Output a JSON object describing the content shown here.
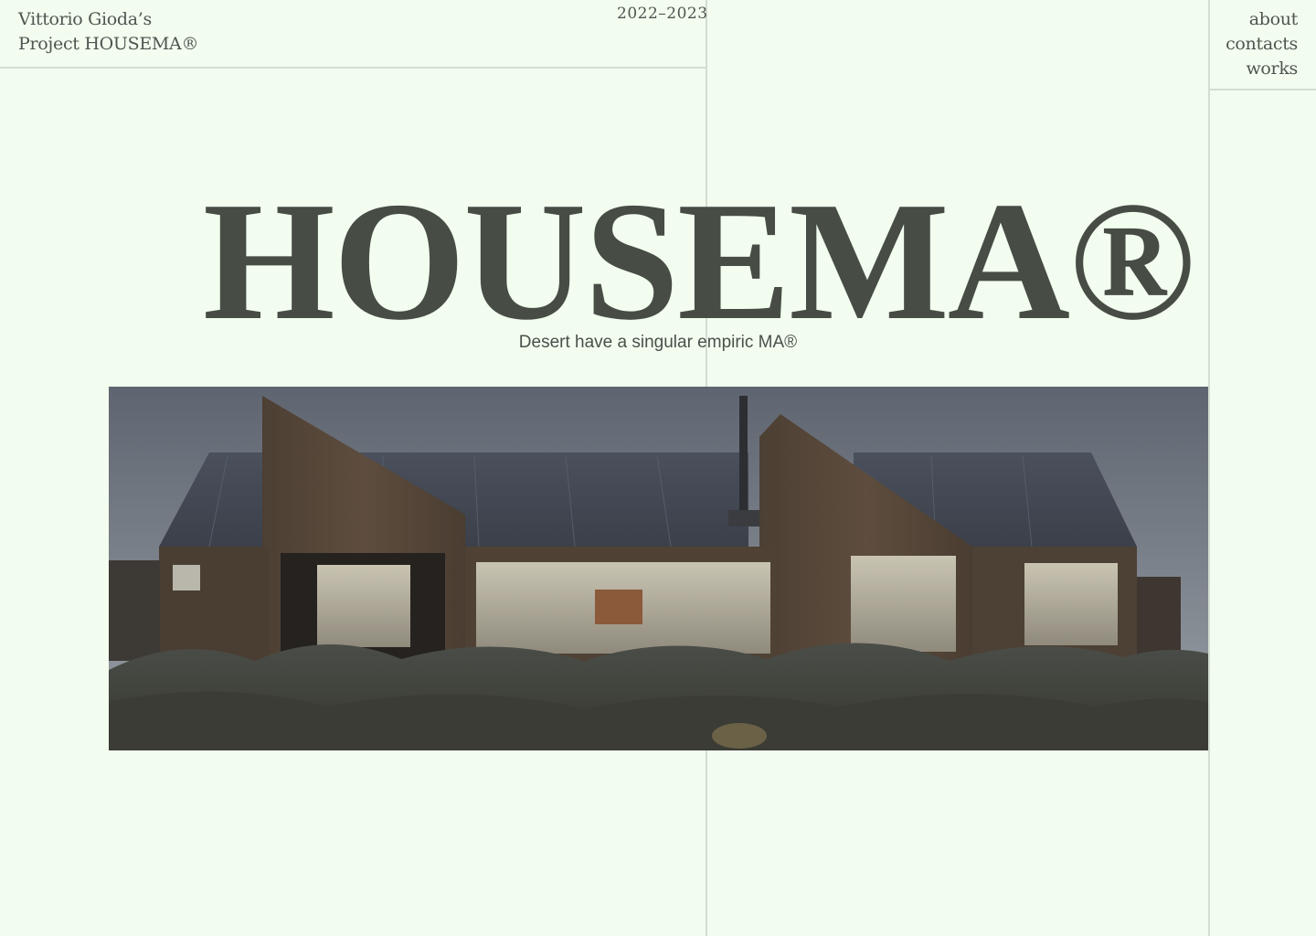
{
  "header": {
    "credit_line1": "Vittorio Gioda’s",
    "credit_line2": "Project HOUSEMA®",
    "years": "2022–2023"
  },
  "nav": {
    "items": [
      {
        "label": "about"
      },
      {
        "label": "contacts"
      },
      {
        "label": "works"
      }
    ]
  },
  "hero": {
    "title": "HOUSEMA®",
    "tagline": "Desert have a singular empiric MA®"
  },
  "colors": {
    "background": "#f2fdef",
    "text": "#474d45",
    "gridline": "#d3ddd0"
  }
}
